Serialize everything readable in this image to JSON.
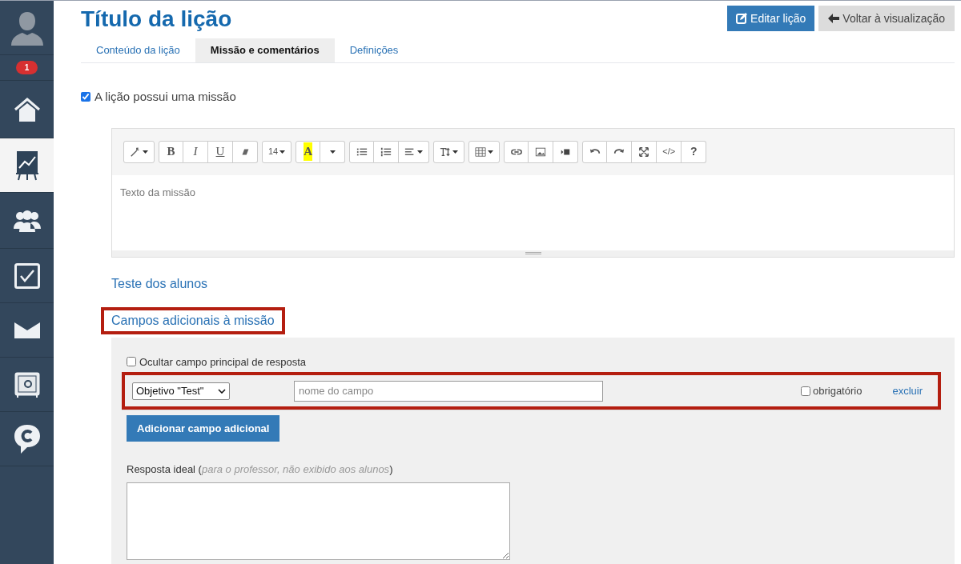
{
  "sidebar": {
    "items": [
      {
        "kind": "avatar",
        "selected": false
      },
      {
        "kind": "badge",
        "count": "1",
        "selected": false
      },
      {
        "kind": "home",
        "selected": false
      },
      {
        "kind": "chart",
        "selected": true
      },
      {
        "kind": "people",
        "selected": false
      },
      {
        "kind": "check",
        "selected": false
      },
      {
        "kind": "mail",
        "selected": false
      },
      {
        "kind": "safe",
        "selected": false
      },
      {
        "kind": "chat",
        "selected": false
      }
    ]
  },
  "header": {
    "title": "Título da lição",
    "buttons": [
      {
        "kind": "primary",
        "label": "Editar lição"
      },
      {
        "kind": "secondary",
        "label": "Voltar à visualização"
      }
    ]
  },
  "tabs": [
    {
      "label": "Conteúdo da lição",
      "selected": false
    },
    {
      "label": "Missão e comentários",
      "selected": true
    },
    {
      "label": "Definições",
      "selected": false
    }
  ],
  "has_mission": {
    "label": "A lição possui uma missão",
    "checked": true
  },
  "editor": {
    "toolbar": [
      [
        {
          "kind": "magic"
        }
      ],
      [
        {
          "kind": "bold",
          "label": "B"
        },
        {
          "kind": "italic",
          "label": "I"
        },
        {
          "kind": "underline",
          "label": "U"
        },
        {
          "kind": "eraser"
        }
      ],
      [
        {
          "kind": "fontsize",
          "label": "14"
        }
      ],
      [
        {
          "kind": "highlight",
          "label": "A"
        },
        {
          "kind": "caret"
        }
      ],
      [
        {
          "kind": "bullets"
        },
        {
          "kind": "numbers"
        },
        {
          "kind": "align"
        }
      ],
      [
        {
          "kind": "textheight"
        }
      ],
      [
        {
          "kind": "table"
        }
      ],
      [
        {
          "kind": "link"
        },
        {
          "kind": "image"
        },
        {
          "kind": "video"
        }
      ],
      [
        {
          "kind": "undo"
        },
        {
          "kind": "redo"
        },
        {
          "kind": "fullscreen"
        },
        {
          "kind": "code",
          "label": "</>"
        },
        {
          "kind": "help",
          "label": "?"
        }
      ]
    ],
    "placeholder": "Texto da missão"
  },
  "student_test_link": "Teste dos alunos",
  "extra_fields": {
    "heading": "Campos adicionais à missão",
    "highlighted": true,
    "hide_main": {
      "label": "Ocultar campo principal de resposta",
      "checked": false
    },
    "rows": [
      {
        "type": "Objetivo \"Test\"",
        "placeholder": "nome do campo",
        "required_label": "obrigatório",
        "required": false,
        "delete": "excluir",
        "highlighted": true
      }
    ],
    "add_button": "Adicionar campo adicional",
    "ideal_answer_label": "Resposta ideal (*para o professor, não exibido aos alunos*)"
  }
}
